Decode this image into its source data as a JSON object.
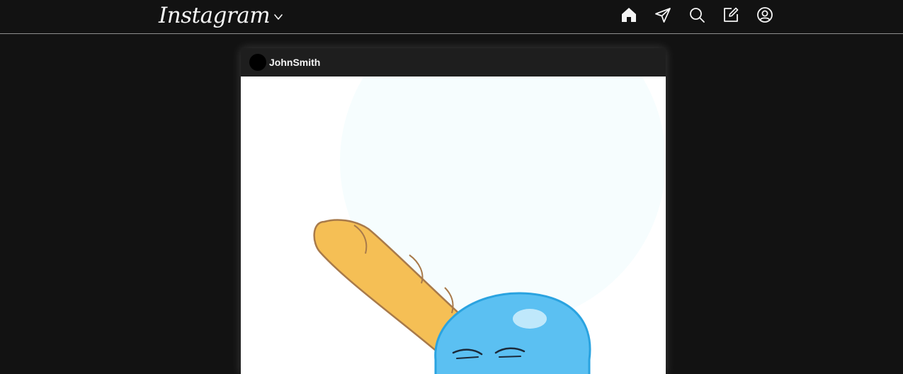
{
  "header": {
    "logo_text": "Instagram",
    "nav_icons": [
      "home-icon",
      "send-icon",
      "search-icon",
      "new-post-icon",
      "profile-icon"
    ]
  },
  "post": {
    "username": "JohnSmith",
    "image_description_icon": "illustration"
  },
  "colors": {
    "background": "#121212",
    "card": "#1e1e1e",
    "text": "#f5f5f5",
    "divider": "#8e8e8e",
    "bread": "#f5bf55",
    "blob": "#5bc0f2"
  }
}
